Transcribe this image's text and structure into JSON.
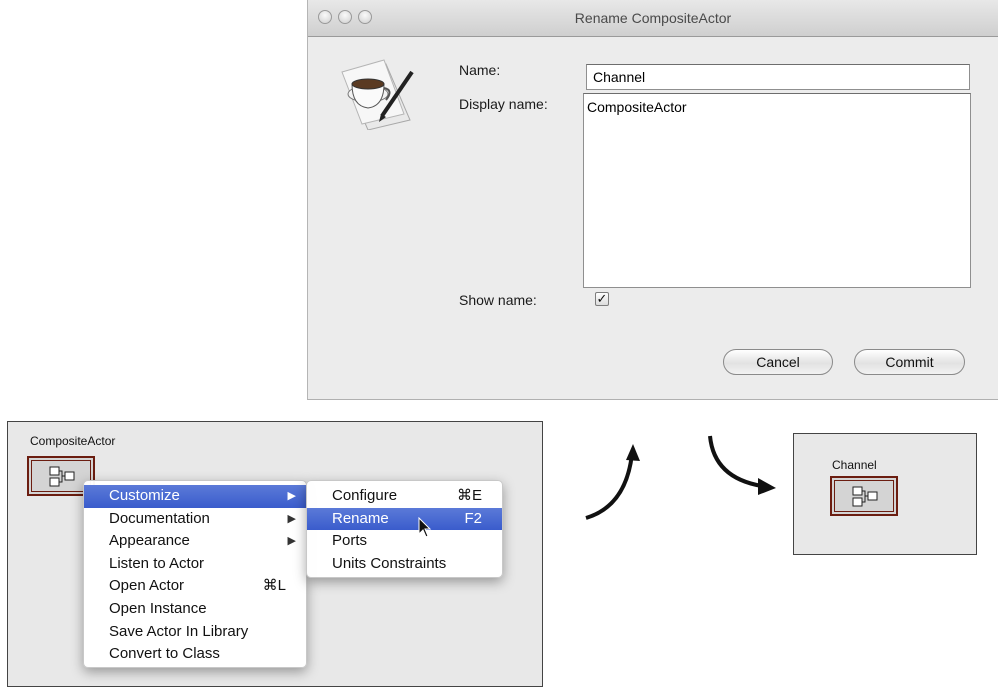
{
  "dialog": {
    "title": "Rename CompositeActor",
    "name_label": "Name:",
    "name_value": "Channel",
    "display_label": "Display name:",
    "display_value": "CompositeActor",
    "show_name_label": "Show name:",
    "show_name_checked": true,
    "show_name_check_glyph": "✓",
    "cancel_label": "Cancel",
    "commit_label": "Commit"
  },
  "canvas": {
    "actor_label": "CompositeActor"
  },
  "context_menu": {
    "items": [
      {
        "label": "Customize",
        "submenu": true,
        "highlighted": true
      },
      {
        "label": "Documentation",
        "submenu": true
      },
      {
        "label": "Appearance",
        "submenu": true
      },
      {
        "label": "Listen to Actor"
      },
      {
        "label": "Open Actor",
        "shortcut": "⌘L"
      },
      {
        "label": "Open Instance"
      },
      {
        "label": "Save Actor In Library"
      },
      {
        "label": "Convert to Class"
      }
    ],
    "submenu_glyph": "▶"
  },
  "submenu": {
    "items": [
      {
        "label": "Configure",
        "shortcut": "⌘E"
      },
      {
        "label": "Rename",
        "shortcut": "F2",
        "highlighted": true
      },
      {
        "label": "Ports"
      },
      {
        "label": "Units Constraints"
      }
    ]
  },
  "result": {
    "actor_label": "Channel"
  },
  "colors": {
    "highlight": "#3a5ccc",
    "actor_border": "#6b1d10"
  }
}
